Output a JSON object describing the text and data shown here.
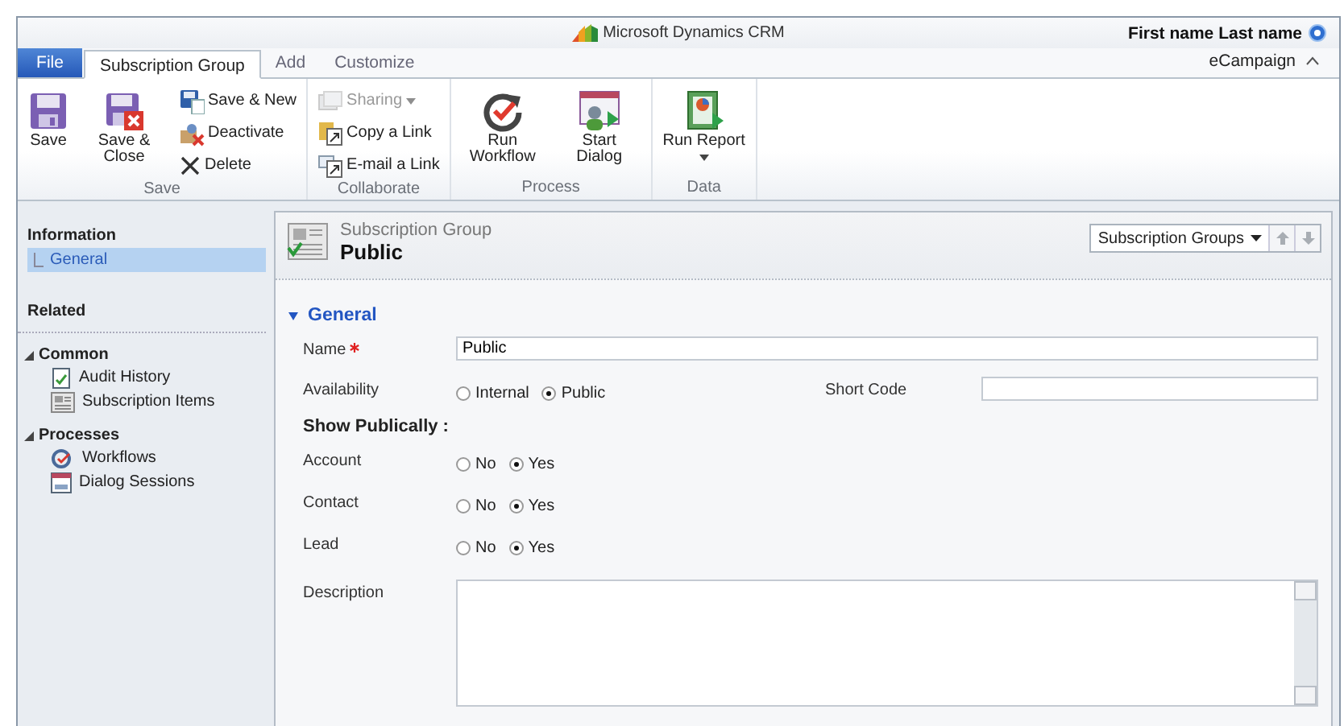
{
  "app": {
    "title": "Microsoft Dynamics CRM",
    "user_name": "First name Last name",
    "organization": "eCampaign"
  },
  "tabs": [
    {
      "label": "File",
      "kind": "file",
      "selected": false
    },
    {
      "label": "Subscription Group",
      "kind": "tab",
      "selected": true
    },
    {
      "label": "Add",
      "kind": "tab",
      "selected": false
    },
    {
      "label": "Customize",
      "kind": "tab",
      "selected": false
    }
  ],
  "ribbon_groups": [
    {
      "label": "Save",
      "buttons": [
        {
          "label": "Save",
          "kind": "large",
          "disabled": false,
          "dropdown": false
        },
        {
          "label": "Save & Close",
          "kind": "large",
          "disabled": false,
          "dropdown": false
        },
        {
          "label": "Save & New",
          "kind": "small",
          "disabled": false,
          "dropdown": false
        },
        {
          "label": "Deactivate",
          "kind": "small",
          "disabled": false,
          "dropdown": false
        },
        {
          "label": "Delete",
          "kind": "small",
          "disabled": false,
          "dropdown": false
        }
      ]
    },
    {
      "label": "Collaborate",
      "buttons": [
        {
          "label": "Sharing",
          "kind": "small",
          "disabled": true,
          "dropdown": true
        },
        {
          "label": "Copy a Link",
          "kind": "small",
          "disabled": false,
          "dropdown": false
        },
        {
          "label": "E-mail a Link",
          "kind": "small",
          "disabled": false,
          "dropdown": false
        }
      ]
    },
    {
      "label": "Process",
      "buttons": [
        {
          "label": "Run Workflow",
          "kind": "large",
          "disabled": false,
          "dropdown": false
        },
        {
          "label": "Start Dialog",
          "kind": "large",
          "disabled": false,
          "dropdown": false
        }
      ]
    },
    {
      "label": "Data",
      "buttons": [
        {
          "label": "Run Report",
          "kind": "large",
          "disabled": false,
          "dropdown": true
        }
      ]
    }
  ],
  "sidebar": {
    "information": {
      "title": "Information",
      "items": [
        {
          "label": "General",
          "selected": true
        }
      ]
    },
    "related_title": "Related",
    "groups": [
      {
        "label": "Common",
        "expanded": true,
        "items": [
          {
            "label": "Audit History",
            "selected": false
          },
          {
            "label": "Subscription Items",
            "selected": false
          }
        ]
      },
      {
        "label": "Processes",
        "expanded": true,
        "items": [
          {
            "label": "Workflows",
            "selected": false
          },
          {
            "label": "Dialog Sessions",
            "selected": false
          }
        ]
      }
    ]
  },
  "record": {
    "entity": "Subscription Group",
    "name": "Public",
    "view_selector": "Subscription Groups"
  },
  "section": {
    "title": "General",
    "expanded": true,
    "rows": [
      {
        "kind": "text",
        "label": "Name",
        "required": true,
        "value": "Public"
      },
      {
        "kind": "radio",
        "label": "Availability",
        "options": [
          {
            "label": "Internal",
            "selected": false
          },
          {
            "label": "Public",
            "selected": true
          }
        ],
        "side_field": {
          "label": "Short Code"
        }
      },
      {
        "kind": "heading",
        "label": "Show Publically :"
      },
      {
        "kind": "radio",
        "label": "Account",
        "options": [
          {
            "label": "No",
            "selected": false
          },
          {
            "label": "Yes",
            "selected": true
          }
        ]
      },
      {
        "kind": "radio",
        "label": "Contact",
        "options": [
          {
            "label": "No",
            "selected": false
          },
          {
            "label": "Yes",
            "selected": true
          }
        ]
      },
      {
        "kind": "radio",
        "label": "Lead",
        "options": [
          {
            "label": "No",
            "selected": false
          },
          {
            "label": "Yes",
            "selected": true
          }
        ]
      },
      {
        "kind": "textarea",
        "label": "Description"
      }
    ]
  }
}
